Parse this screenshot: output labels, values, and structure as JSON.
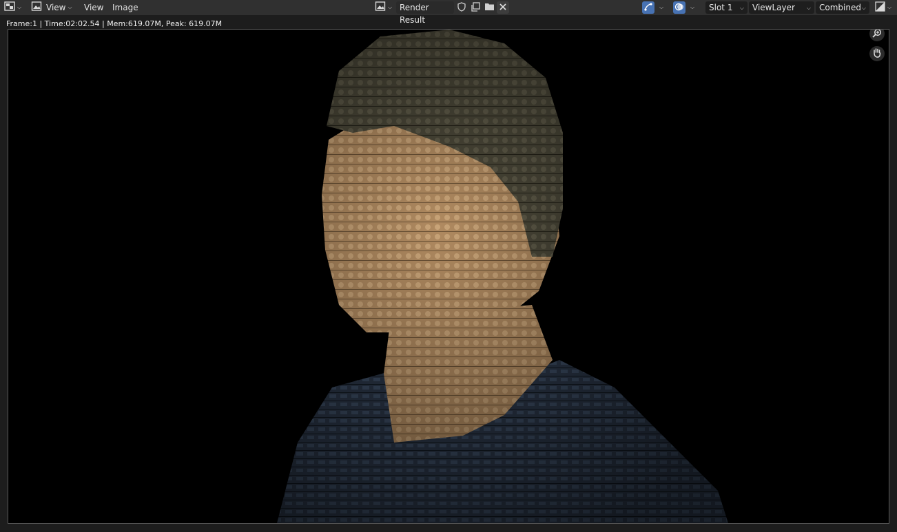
{
  "header": {
    "view_menu_label": "View",
    "menus": [
      "View",
      "Image"
    ],
    "image_name": "Render Result",
    "slot": "Slot 1",
    "view_layer": "ViewLayer",
    "pass": "Combined"
  },
  "status": {
    "text": "Frame:1 | Time:02:02.54 | Mem:619.07M, Peak: 619.07M"
  },
  "colors": {
    "accent": "#4772b3",
    "header_bg": "#303030",
    "field_bg": "#1e1e1e"
  },
  "icons": {
    "editor_type": "image-editor-icon",
    "mode": "view-mode-icon",
    "browse_image": "image-browse-icon",
    "fake_user": "shield-icon",
    "new_image": "duplicate-icon",
    "open_image": "folder-icon",
    "unlink": "close-icon",
    "gizmo": "gizmo-icon",
    "overlays": "overlays-icon",
    "display_channels": "display-channels-icon",
    "zoom": "zoom-icon",
    "pan": "hand-icon"
  }
}
